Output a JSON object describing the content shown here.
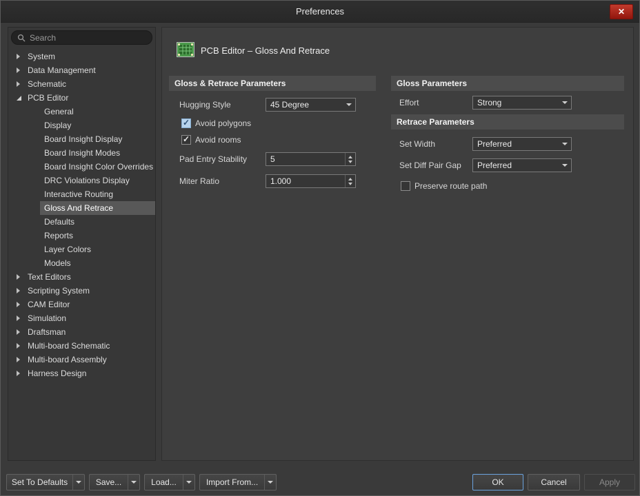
{
  "window": {
    "title": "Preferences",
    "close_glyph": "✕"
  },
  "sidebar": {
    "search_placeholder": "Search",
    "items": [
      {
        "label": "System",
        "type": "collapsed"
      },
      {
        "label": "Data Management",
        "type": "collapsed"
      },
      {
        "label": "Schematic",
        "type": "collapsed"
      },
      {
        "label": "PCB Editor",
        "type": "expanded"
      },
      {
        "label": "General",
        "type": "child"
      },
      {
        "label": "Display",
        "type": "child"
      },
      {
        "label": "Board Insight Display",
        "type": "child"
      },
      {
        "label": "Board Insight Modes",
        "type": "child"
      },
      {
        "label": "Board Insight Color Overrides",
        "type": "child"
      },
      {
        "label": "DRC Violations Display",
        "type": "child"
      },
      {
        "label": "Interactive Routing",
        "type": "child"
      },
      {
        "label": "Gloss And Retrace",
        "type": "child",
        "selected": true
      },
      {
        "label": "Defaults",
        "type": "child"
      },
      {
        "label": "Reports",
        "type": "child"
      },
      {
        "label": "Layer Colors",
        "type": "child"
      },
      {
        "label": "Models",
        "type": "child"
      },
      {
        "label": "Text Editors",
        "type": "collapsed"
      },
      {
        "label": "Scripting System",
        "type": "collapsed"
      },
      {
        "label": "CAM Editor",
        "type": "collapsed"
      },
      {
        "label": "Simulation",
        "type": "collapsed"
      },
      {
        "label": "Draftsman",
        "type": "collapsed"
      },
      {
        "label": "Multi-board Schematic",
        "type": "collapsed"
      },
      {
        "label": "Multi-board Assembly",
        "type": "collapsed"
      },
      {
        "label": "Harness Design",
        "type": "collapsed"
      }
    ]
  },
  "page": {
    "title": "PCB Editor – Gloss And Retrace"
  },
  "gloss_retrace": {
    "section_title": "Gloss & Retrace Parameters",
    "hugging_style": {
      "label": "Hugging Style",
      "value": "45 Degree"
    },
    "avoid_polygons": {
      "label": "Avoid polygons",
      "checked": true
    },
    "avoid_rooms": {
      "label": "Avoid rooms",
      "checked": true
    },
    "pad_entry_stability": {
      "label": "Pad Entry Stability",
      "value": "5"
    },
    "miter_ratio": {
      "label": "Miter Ratio",
      "value": "1.000"
    }
  },
  "gloss_params": {
    "section_title": "Gloss Parameters",
    "effort": {
      "label": "Effort",
      "value": "Strong"
    }
  },
  "retrace_params": {
    "section_title": "Retrace Parameters",
    "set_width": {
      "label": "Set Width",
      "value": "Preferred"
    },
    "set_diff_pair_gap": {
      "label": "Set Diff Pair Gap",
      "value": "Preferred"
    },
    "preserve_route_path": {
      "label": "Preserve route path",
      "checked": false
    }
  },
  "footer": {
    "set_to_defaults": "Set To Defaults",
    "save": "Save...",
    "load": "Load...",
    "import_from": "Import From...",
    "ok": "OK",
    "cancel": "Cancel",
    "apply": "Apply"
  },
  "colors": {
    "accent_blue": "#6ba3de",
    "close_red": "#b3271e",
    "selected_row": "#585858"
  }
}
